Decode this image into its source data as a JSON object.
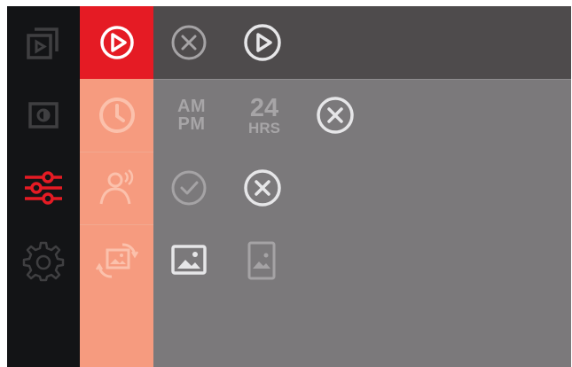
{
  "colors": {
    "rail_bg": "#131416",
    "rail_icon": "#3f3f41",
    "active_red": "#e51b24",
    "menu_bg": "#f69b7f",
    "menu_icon": "#fbc1ac",
    "panel_bg": "#7b797b",
    "panel_top_bg": "#4e4b4c",
    "icon_light": "#e6e6e8",
    "icon_dim": "#a5a3a5"
  },
  "rail": [
    {
      "icon": "slideshow-icon",
      "active": false
    },
    {
      "icon": "brightness-icon",
      "active": false
    },
    {
      "icon": "sliders-icon",
      "active": true
    },
    {
      "icon": "gear-icon",
      "active": false
    }
  ],
  "menu": [
    {
      "icon": "play-circle-icon",
      "active": true
    },
    {
      "icon": "clock-icon",
      "active": false
    },
    {
      "icon": "motion-sensor-icon",
      "active": false
    },
    {
      "icon": "rotate-image-icon",
      "active": false
    }
  ],
  "options": {
    "row1": [
      "close-circle-icon",
      "play-circle-icon"
    ],
    "row2": {
      "ampm_top": "AM",
      "ampm_bottom": "PM",
      "hrs_number": "24",
      "hrs_label": "HRS",
      "icon": "close-circle-icon"
    },
    "row3": [
      "check-circle-icon",
      "close-circle-icon"
    ],
    "row4": [
      "landscape-image-icon",
      "portrait-image-icon"
    ]
  }
}
